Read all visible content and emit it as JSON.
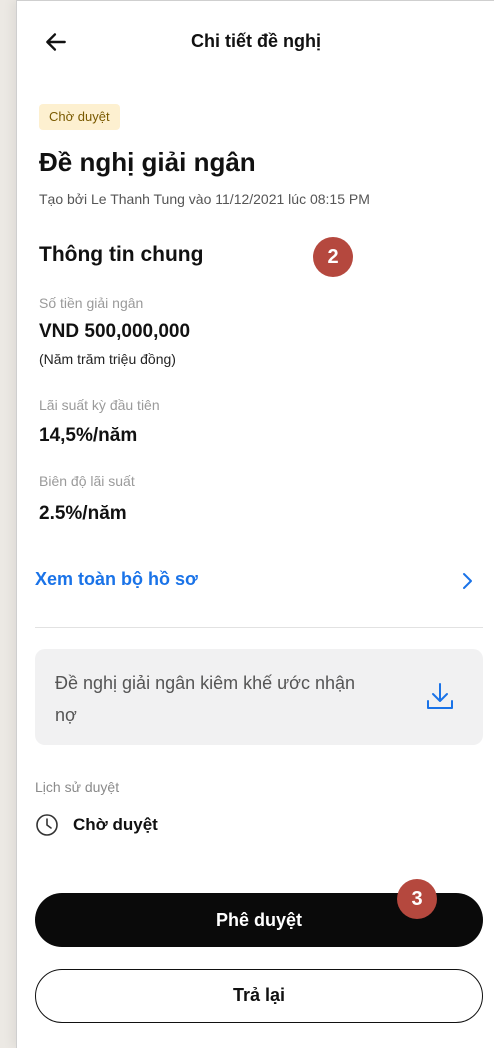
{
  "header": {
    "title": "Chi tiết đề nghị"
  },
  "request": {
    "status": "Chờ duyệt",
    "title": "Đề nghị giải ngân",
    "created_by": "Tạo bởi Le Thanh Tung vào 11/12/2021 lúc 08:15 PM"
  },
  "general_info": {
    "title": "Thông tin chung",
    "amount_label": "Số tiền giải ngân",
    "amount_value": "VND 500,000,000",
    "amount_words": "(Năm trăm triệu đồng)",
    "rate_label": "Lãi suất kỳ đầu tiên",
    "rate_value": "14,5%/năm",
    "margin_label": "Biên độ lãi suất",
    "margin_value": "2.5%/năm"
  },
  "view_all_link": "Xem toàn bộ hồ sơ",
  "attachment": {
    "name": "Đề nghị giải ngân kiêm khế ước nhận nợ",
    "icon": "download-icon"
  },
  "history": {
    "label": "Lịch sử duyệt",
    "status": "Chờ duyệt",
    "icon": "clock-icon"
  },
  "actions": {
    "approve": "Phê duyệt",
    "return": "Trả lại"
  },
  "annotations": {
    "badge_2": "2",
    "badge_3": "3"
  },
  "colors": {
    "accent_link": "#1a73e8",
    "status_pill_bg": "#fdf0d0",
    "badge": "#b5483e",
    "primary_button": "#0a0a0a"
  }
}
